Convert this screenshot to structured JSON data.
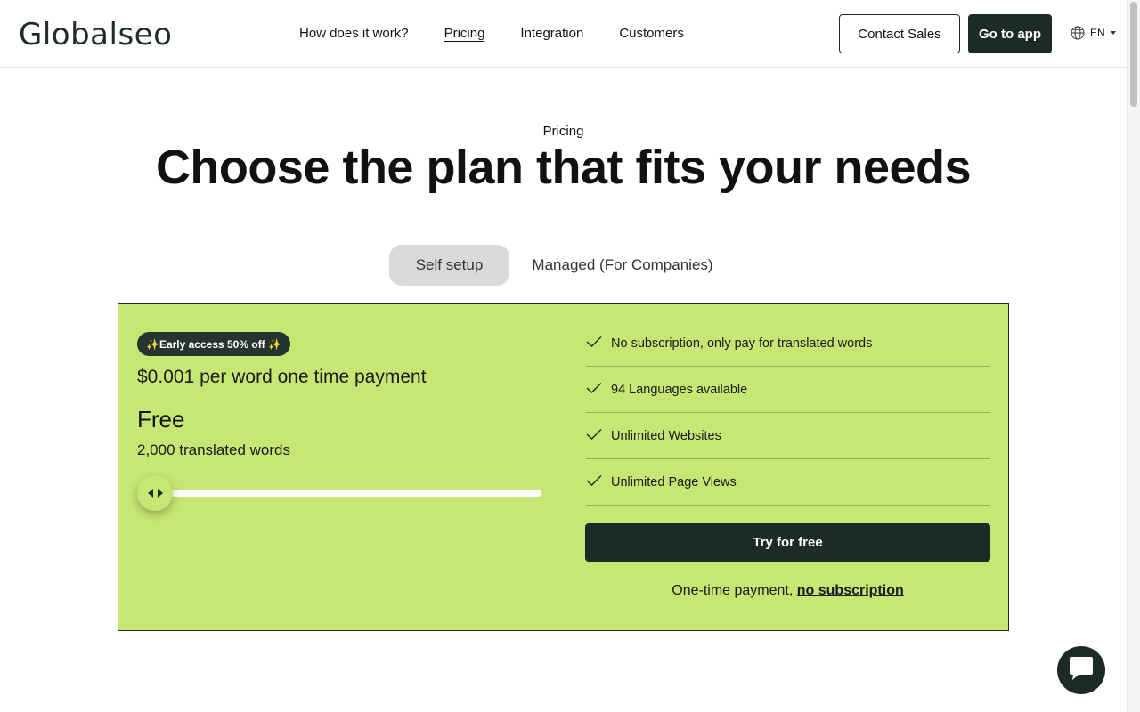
{
  "header": {
    "logo": "Globalseo",
    "nav": [
      "How does it work?",
      "Pricing",
      "Integration",
      "Customers"
    ],
    "active_nav": "Pricing",
    "contact_sales": "Contact Sales",
    "go_to_app": "Go to app",
    "language": "EN"
  },
  "hero": {
    "eyebrow": "Pricing",
    "headline": "Choose the plan that fits your needs"
  },
  "tabs": {
    "self_setup": "Self setup",
    "managed": "Managed (For Companies)",
    "selected": "Self setup"
  },
  "plan": {
    "badge": "✨Early access 50% off ✨",
    "price": "$0.001 per word one time payment",
    "name": "Free",
    "words": "2,000 translated words",
    "slider_level": 0,
    "features": [
      "No subscription, only pay for translated words",
      "94 Languages available",
      "Unlimited Websites",
      "Unlimited Page Views"
    ],
    "cta": "Try for free",
    "note_prefix": "One-time payment, ",
    "note_link": "no subscription"
  },
  "colors": {
    "accent_green": "#c7e774",
    "dark": "#1c2b27",
    "tab_selected_bg": "#d9d9d9"
  },
  "icons": {
    "language": "globe-icon",
    "feature": "check-icon",
    "chat": "chat-bubble-icon",
    "slider": "left-right-arrows-icon"
  }
}
